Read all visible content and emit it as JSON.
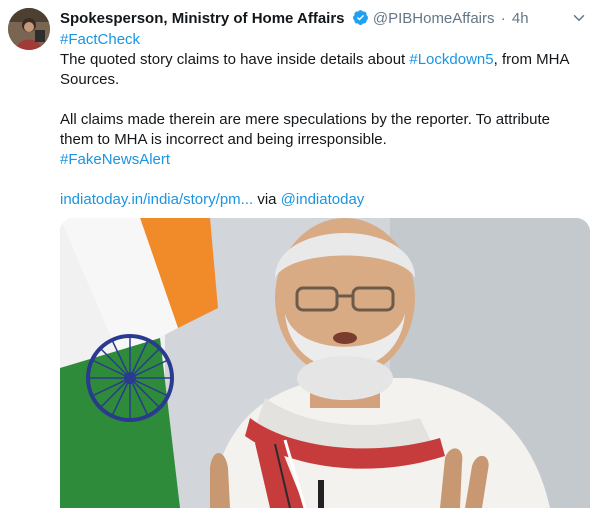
{
  "tweet": {
    "author_name": "Spokesperson, Ministry of Home Affairs",
    "author_handle": "@PIBHomeAffairs",
    "separator": "·",
    "timestamp": "4h",
    "hashtag_factcheck": "#FactCheck",
    "line1_pre": "The quoted story claims to have inside details about ",
    "hashtag_lockdown": "#Lockdown5",
    "line1_post": ", from MHA Sources.",
    "paragraph2": "All claims made therein are mere speculations by the reporter. To attribute them to MHA is incorrect and being irresponsible.",
    "hashtag_fakenews": "#FakeNewsAlert",
    "url_text": "indiatoday.in/india/story/pm...",
    "via_text": " via ",
    "via_handle": "@indiatoday"
  },
  "icons": {
    "verified": "verified-badge-icon",
    "menu": "chevron-down-icon"
  },
  "colors": {
    "link": "#1b95e0",
    "text": "#14171a",
    "muted": "#657786",
    "verified": "#1da1f2"
  }
}
